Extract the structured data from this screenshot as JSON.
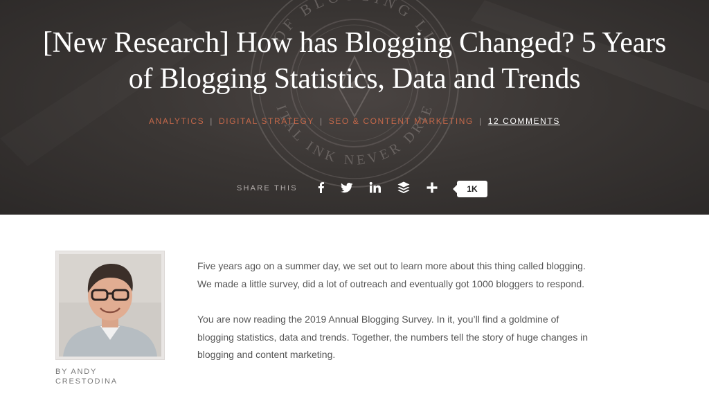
{
  "header": {
    "title": "[New Research] How has Blogging Changed? 5 Years of Blogging Statistics, Data and Trends",
    "categories": [
      "ANALYTICS",
      "DIGITAL STRATEGY",
      "SEO & CONTENT MARKETING"
    ],
    "separator": "|",
    "comments": "12 COMMENTS"
  },
  "share": {
    "label": "SHARE THIS",
    "icons": [
      "facebook-icon",
      "twitter-icon",
      "linkedin-icon",
      "buffer-icon",
      "plus-icon"
    ],
    "count": "1K"
  },
  "seal": {
    "text_top": "OF BLOGGING LI",
    "text_bottom": "GITAL INK NEVER DRIES"
  },
  "author": {
    "byline": "BY ANDY CRESTODINA"
  },
  "article": {
    "paragraphs": [
      "Five years ago on a summer day, we set out to learn more about this thing called blogging. We made a little survey, did a lot of outreach and eventually got 1000 bloggers to respond.",
      "You are now reading the 2019 Annual Blogging Survey. In it, you’ll find a goldmine of blogging statistics, data and trends. Together, the numbers tell the story of huge changes in blogging and content marketing."
    ]
  },
  "colors": {
    "accent": "#c4684a",
    "hero_bg": "#3a3634",
    "text": "#555555"
  }
}
